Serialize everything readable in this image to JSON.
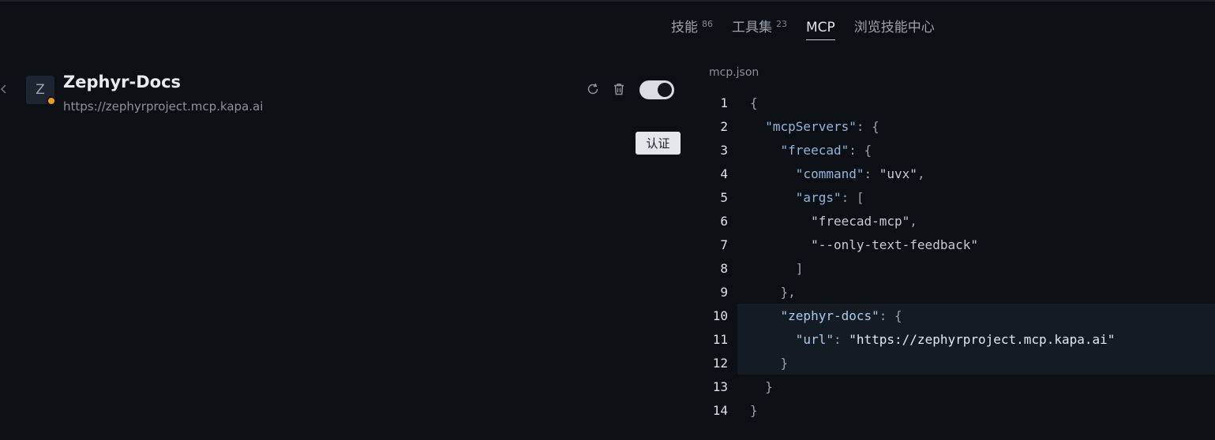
{
  "tabs": [
    {
      "label": "技能",
      "count": "86"
    },
    {
      "label": "工具集",
      "count": "23"
    },
    {
      "label": "MCP",
      "count": ""
    },
    {
      "label": "浏览技能中心",
      "count": ""
    }
  ],
  "server": {
    "avatar_letter": "Z",
    "name": "Zephyr-Docs",
    "url": "https://zephyrproject.mcp.kapa.ai",
    "status_color": "#f29b1a",
    "enabled": true
  },
  "auth_button": "认证",
  "editor": {
    "filename": "mcp.json",
    "highlighted_lines": [
      10,
      11,
      12
    ],
    "line_numbers": [
      "1",
      "2",
      "3",
      "4",
      "5",
      "6",
      "7",
      "8",
      "9",
      "10",
      "11",
      "12",
      "13",
      "14"
    ],
    "lines": [
      {
        "indent": "",
        "tokens": [
          {
            "t": "punc",
            "v": "{"
          }
        ]
      },
      {
        "indent": "  ",
        "tokens": [
          {
            "t": "key",
            "v": "\"mcpServers\""
          },
          {
            "t": "punc",
            "v": ": {"
          }
        ]
      },
      {
        "indent": "    ",
        "tokens": [
          {
            "t": "key",
            "v": "\"freecad\""
          },
          {
            "t": "punc",
            "v": ": {"
          }
        ]
      },
      {
        "indent": "      ",
        "tokens": [
          {
            "t": "key",
            "v": "\"command\""
          },
          {
            "t": "punc",
            "v": ": "
          },
          {
            "t": "str",
            "v": "\"uvx\""
          },
          {
            "t": "punc",
            "v": ","
          }
        ]
      },
      {
        "indent": "      ",
        "tokens": [
          {
            "t": "key",
            "v": "\"args\""
          },
          {
            "t": "punc",
            "v": ": ["
          }
        ]
      },
      {
        "indent": "        ",
        "tokens": [
          {
            "t": "str",
            "v": "\"freecad-mcp\""
          },
          {
            "t": "punc",
            "v": ","
          }
        ]
      },
      {
        "indent": "        ",
        "tokens": [
          {
            "t": "str",
            "v": "\"--only-text-feedback\""
          }
        ]
      },
      {
        "indent": "      ",
        "tokens": [
          {
            "t": "punc",
            "v": "]"
          }
        ]
      },
      {
        "indent": "    ",
        "tokens": [
          {
            "t": "punc",
            "v": "},"
          }
        ]
      },
      {
        "indent": "    ",
        "tokens": [
          {
            "t": "key strong",
            "v": "\"zephyr-docs\""
          },
          {
            "t": "punc",
            "v": ": {"
          }
        ]
      },
      {
        "indent": "      ",
        "tokens": [
          {
            "t": "key strong",
            "v": "\"url\""
          },
          {
            "t": "punc",
            "v": ": "
          },
          {
            "t": "str strongw",
            "v": "\"https://zephyrproject.mcp.kapa.ai\""
          }
        ]
      },
      {
        "indent": "    ",
        "tokens": [
          {
            "t": "punc",
            "v": "}"
          }
        ]
      },
      {
        "indent": "  ",
        "tokens": [
          {
            "t": "punc",
            "v": "}"
          }
        ]
      },
      {
        "indent": "",
        "tokens": [
          {
            "t": "punc",
            "v": "}"
          }
        ]
      }
    ]
  }
}
